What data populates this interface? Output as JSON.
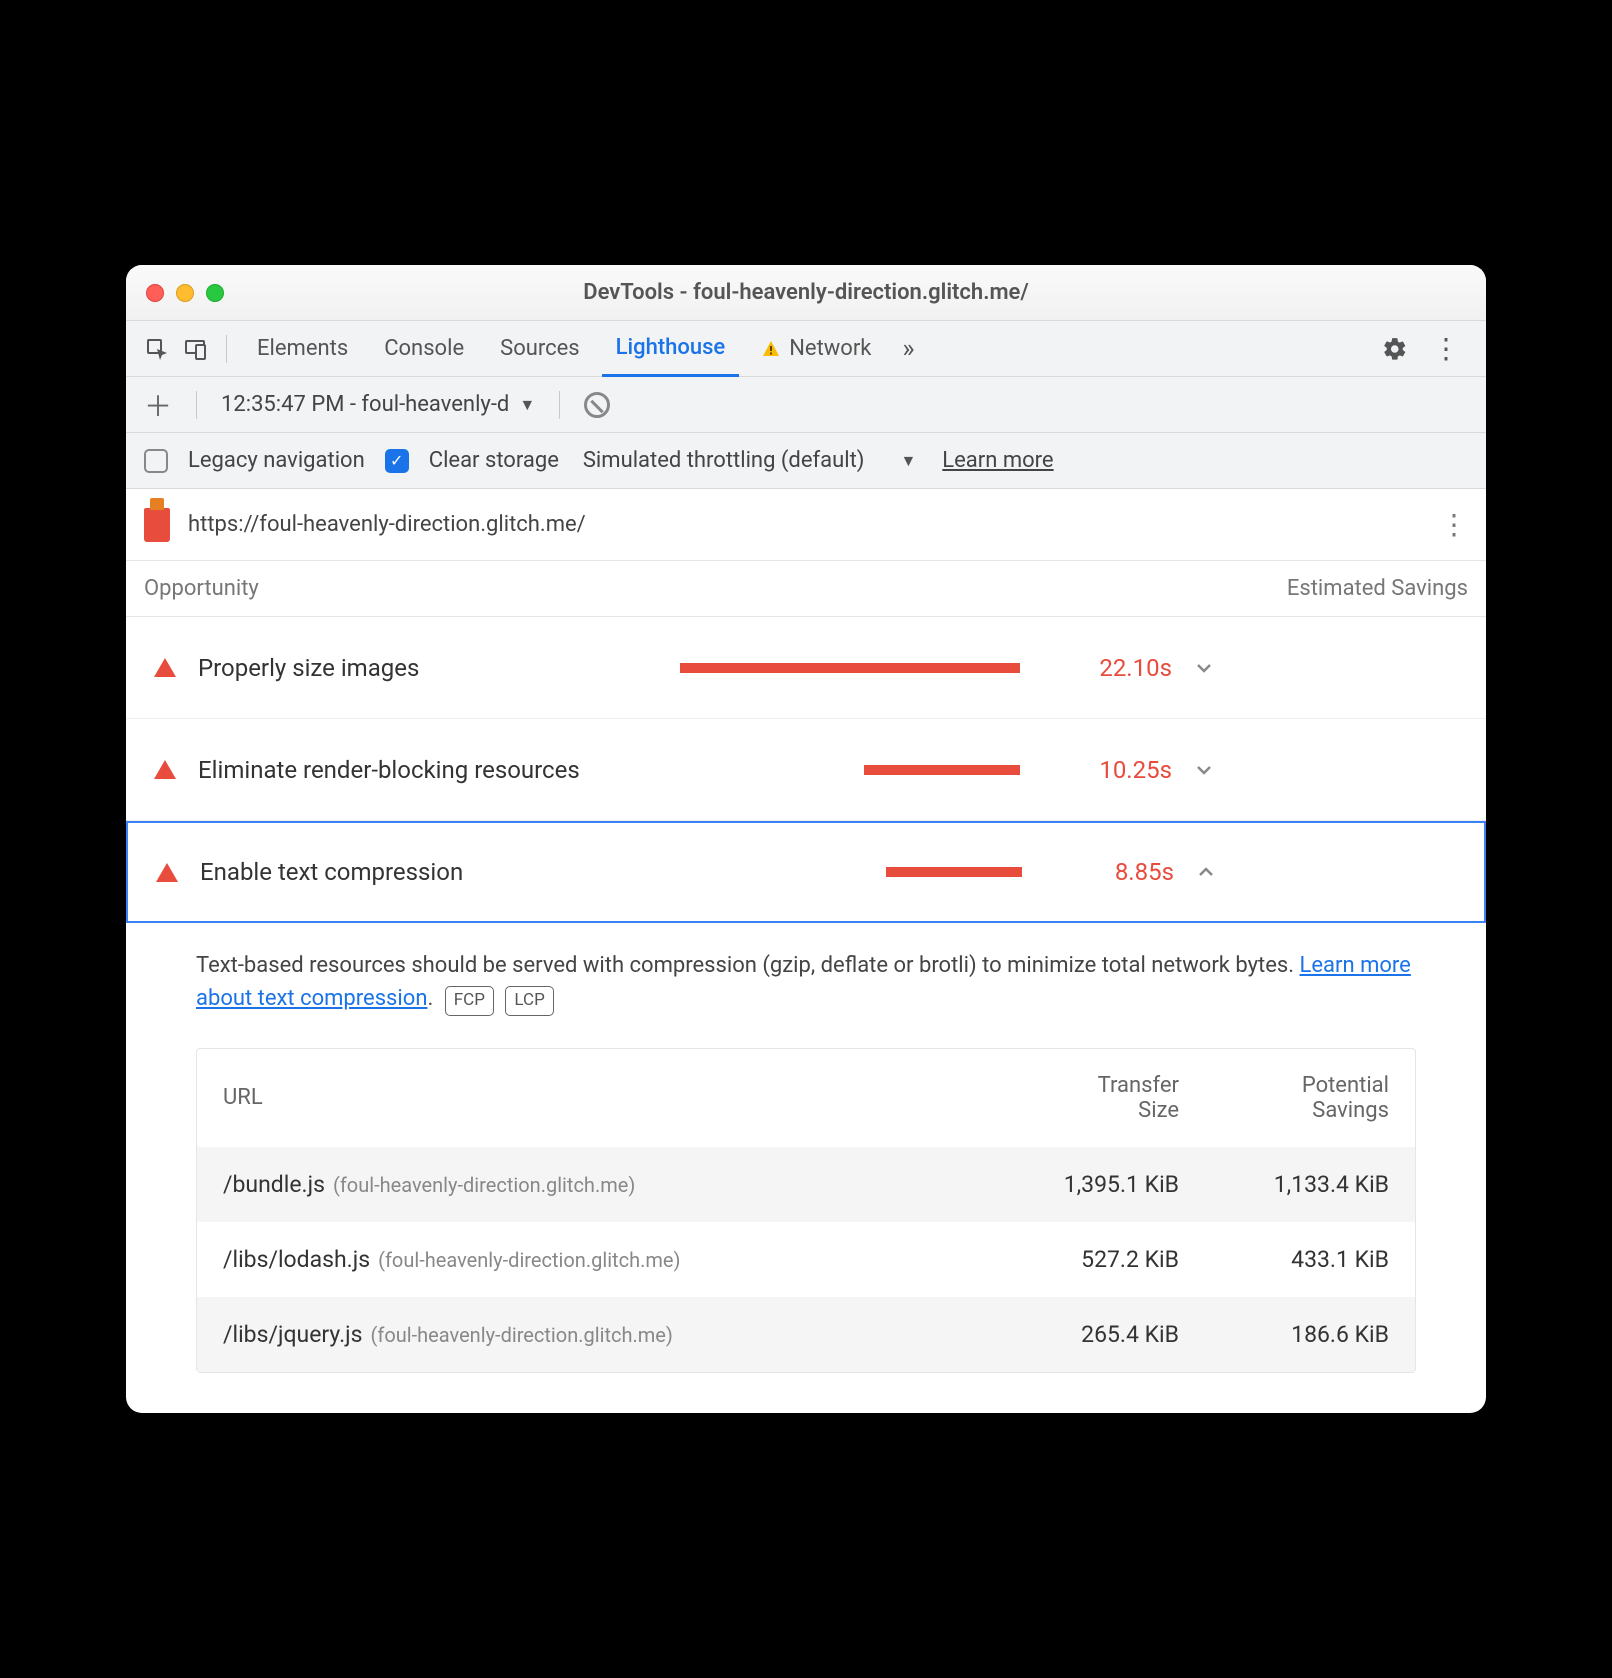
{
  "window": {
    "title": "DevTools - foul-heavenly-direction.glitch.me/"
  },
  "tabs": {
    "items": [
      "Elements",
      "Console",
      "Sources",
      "Lighthouse",
      "Network"
    ],
    "selected": "Lighthouse"
  },
  "subbar": {
    "run_label": "12:35:47 PM - foul-heavenly-d"
  },
  "options": {
    "legacy_label": "Legacy navigation",
    "clear_label": "Clear storage",
    "throttling_label": "Simulated throttling (default)",
    "learn_more": "Learn more"
  },
  "url_row": {
    "url": "https://foul-heavenly-direction.glitch.me/"
  },
  "header": {
    "opportunity": "Opportunity",
    "savings": "Estimated Savings"
  },
  "opportunities": [
    {
      "title": "Properly size images",
      "time": "22.10s",
      "bar_pct": 100,
      "expanded": false
    },
    {
      "title": "Eliminate render-blocking resources",
      "time": "10.25s",
      "bar_pct": 46,
      "expanded": false
    },
    {
      "title": "Enable text compression",
      "time": "8.85s",
      "bar_pct": 40,
      "expanded": true
    }
  ],
  "detail": {
    "text": "Text-based resources should be served with compression (gzip, deflate or brotli) to minimize total network bytes. ",
    "link": "Learn more about text compression",
    "badges": [
      "FCP",
      "LCP"
    ]
  },
  "table": {
    "headers": {
      "url": "URL",
      "transfer": "Transfer Size",
      "potential": "Potential Savings"
    },
    "rows": [
      {
        "path": "/bundle.js",
        "host": "(foul-heavenly-direction.glitch.me)",
        "transfer": "1,395.1 KiB",
        "potential": "1,133.4 KiB"
      },
      {
        "path": "/libs/lodash.js",
        "host": "(foul-heavenly-direction.glitch.me)",
        "transfer": "527.2 KiB",
        "potential": "433.1 KiB"
      },
      {
        "path": "/libs/jquery.js",
        "host": "(foul-heavenly-direction.glitch.me)",
        "transfer": "265.4 KiB",
        "potential": "186.6 KiB"
      }
    ]
  }
}
